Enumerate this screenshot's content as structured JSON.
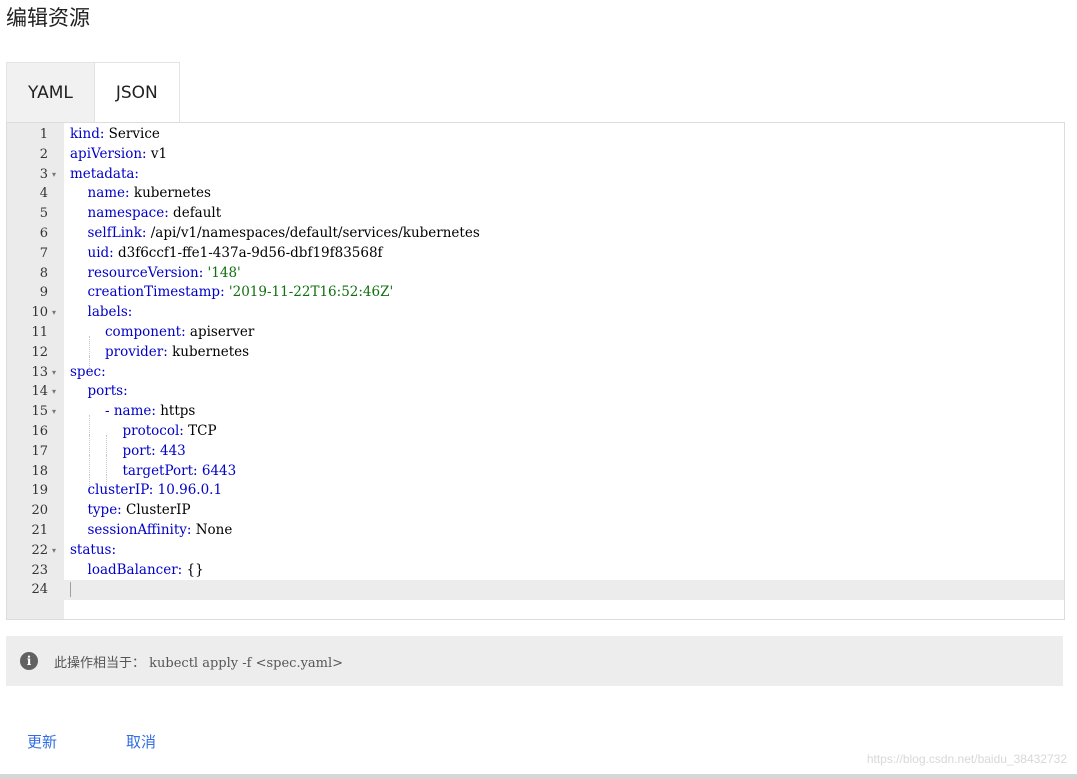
{
  "page": {
    "title": "编辑资源"
  },
  "tabs": [
    {
      "label": "YAML",
      "active": false
    },
    {
      "label": "JSON",
      "active": true
    }
  ],
  "editor": {
    "lines": [
      {
        "n": "1",
        "indent": 0,
        "guides": 0,
        "fold": false,
        "key": "kind:",
        "rest": " Service",
        "rest_type": "plain"
      },
      {
        "n": "2",
        "indent": 0,
        "guides": 0,
        "fold": false,
        "key": "apiVersion:",
        "rest": " v1",
        "rest_type": "plain"
      },
      {
        "n": "3",
        "indent": 0,
        "guides": 0,
        "fold": true,
        "key": "metadata:",
        "rest": "",
        "rest_type": "plain"
      },
      {
        "n": "4",
        "indent": 1,
        "guides": 0,
        "fold": false,
        "key": "name:",
        "rest": " kubernetes",
        "rest_type": "plain"
      },
      {
        "n": "5",
        "indent": 1,
        "guides": 0,
        "fold": false,
        "key": "namespace:",
        "rest": " default",
        "rest_type": "plain"
      },
      {
        "n": "6",
        "indent": 1,
        "guides": 0,
        "fold": false,
        "key": "selfLink:",
        "rest": " /api/v1/namespaces/default/services/kubernetes",
        "rest_type": "plain"
      },
      {
        "n": "7",
        "indent": 1,
        "guides": 0,
        "fold": false,
        "key": "uid:",
        "rest": " d3f6ccf1-ffe1-437a-9d56-dbf19f83568f",
        "rest_type": "plain"
      },
      {
        "n": "8",
        "indent": 1,
        "guides": 0,
        "fold": false,
        "key": "resourceVersion:",
        "rest": " '148'",
        "rest_type": "string"
      },
      {
        "n": "9",
        "indent": 1,
        "guides": 0,
        "fold": false,
        "key": "creationTimestamp:",
        "rest": " '2019-11-22T16:52:46Z'",
        "rest_type": "string"
      },
      {
        "n": "10",
        "indent": 1,
        "guides": 0,
        "fold": true,
        "key": "labels:",
        "rest": "",
        "rest_type": "plain"
      },
      {
        "n": "11",
        "indent": 2,
        "guides": 1,
        "fold": false,
        "key": "component:",
        "rest": " apiserver",
        "rest_type": "plain"
      },
      {
        "n": "12",
        "indent": 2,
        "guides": 1,
        "fold": false,
        "key": "provider:",
        "rest": " kubernetes",
        "rest_type": "plain"
      },
      {
        "n": "13",
        "indent": 0,
        "guides": 0,
        "fold": true,
        "key": "spec:",
        "rest": "",
        "rest_type": "plain"
      },
      {
        "n": "14",
        "indent": 1,
        "guides": 0,
        "fold": true,
        "key": "ports:",
        "rest": "",
        "rest_type": "plain"
      },
      {
        "n": "15",
        "indent": 2,
        "guides": 1,
        "fold": true,
        "key": "- name:",
        "rest": " https",
        "rest_type": "plain"
      },
      {
        "n": "16",
        "indent": 3,
        "guides": 2,
        "fold": false,
        "key": "protocol:",
        "rest": " TCP",
        "rest_type": "plain"
      },
      {
        "n": "17",
        "indent": 3,
        "guides": 2,
        "fold": false,
        "key": "port:",
        "rest": " 443",
        "rest_type": "number"
      },
      {
        "n": "18",
        "indent": 3,
        "guides": 2,
        "fold": false,
        "key": "targetPort:",
        "rest": " 6443",
        "rest_type": "number"
      },
      {
        "n": "19",
        "indent": 1,
        "guides": 0,
        "fold": false,
        "key": "clusterIP:",
        "rest": " 10.96.0.1",
        "rest_type": "number"
      },
      {
        "n": "20",
        "indent": 1,
        "guides": 0,
        "fold": false,
        "key": "type:",
        "rest": " ClusterIP",
        "rest_type": "plain"
      },
      {
        "n": "21",
        "indent": 1,
        "guides": 0,
        "fold": false,
        "key": "sessionAffinity:",
        "rest": " None",
        "rest_type": "plain"
      },
      {
        "n": "22",
        "indent": 0,
        "guides": 0,
        "fold": true,
        "key": "status:",
        "rest": "",
        "rest_type": "plain"
      },
      {
        "n": "23",
        "indent": 1,
        "guides": 0,
        "fold": false,
        "key": "loadBalancer:",
        "rest": " {}",
        "rest_type": "plain"
      },
      {
        "n": "24",
        "indent": 0,
        "guides": 0,
        "fold": false,
        "key": "",
        "rest": "",
        "rest_type": "plain",
        "active": true
      }
    ]
  },
  "info": {
    "icon": "info-icon",
    "label": "此操作相当于：",
    "command": "kubectl apply -f <spec.yaml>"
  },
  "actions": {
    "update_label": "更新",
    "cancel_label": "取消"
  },
  "footer": {
    "source_link": "https://blog.csdn.net/baidu_38432732"
  },
  "colors": {
    "accent": "#326de6",
    "key": "#0000c8",
    "string": "#107010"
  }
}
